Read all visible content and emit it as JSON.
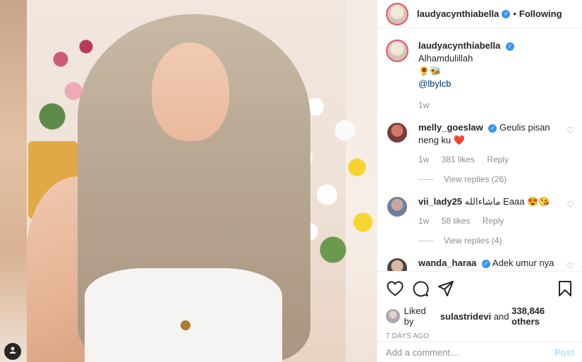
{
  "header": {
    "username": "laudyacynthiabella",
    "dot": "•",
    "following_label": "Following"
  },
  "caption": {
    "username": "laudyacynthiabella",
    "text": "Alhamdulillah",
    "emoji": "🌻🐝",
    "mention": "@lbylcb",
    "time": "1w"
  },
  "comments": [
    {
      "username": "melly_goeslaw",
      "text": "Geulis pisan neng ku",
      "emoji": "❤️",
      "time": "1w",
      "likes": "381 likes",
      "reply_label": "Reply",
      "view_replies": "View replies (26)"
    },
    {
      "username": "vii_lady25",
      "text_rtl": "ماشاءالله",
      "text": "Eaaa",
      "emoji": "😍😘",
      "time": "1w",
      "likes": "58 likes",
      "reply_label": "Reply",
      "view_replies": "View replies (4)"
    },
    {
      "username": "wanda_haraa",
      "text": "Adek umur nya"
    }
  ],
  "actions": {
    "liked_by_prefix": "Liked by",
    "liked_by_user": "sulastridevi",
    "liked_by_suffix": "and",
    "others_count": "338,846 others",
    "date": "7 DAYS AGO"
  },
  "add_comment": {
    "placeholder": "Add a comment…",
    "post_label": "Post"
  },
  "icons": {
    "like": "heart-icon",
    "comment": "comment-icon",
    "share": "share-icon",
    "save": "bookmark-icon",
    "verified": "verified-badge-icon",
    "tag": "user-tag-icon"
  },
  "colors": {
    "verified": "#3897f0",
    "link": "#00376b",
    "muted": "#8e8e8e",
    "post": "#b2dffc",
    "heart_emoji": "#e0245e"
  }
}
